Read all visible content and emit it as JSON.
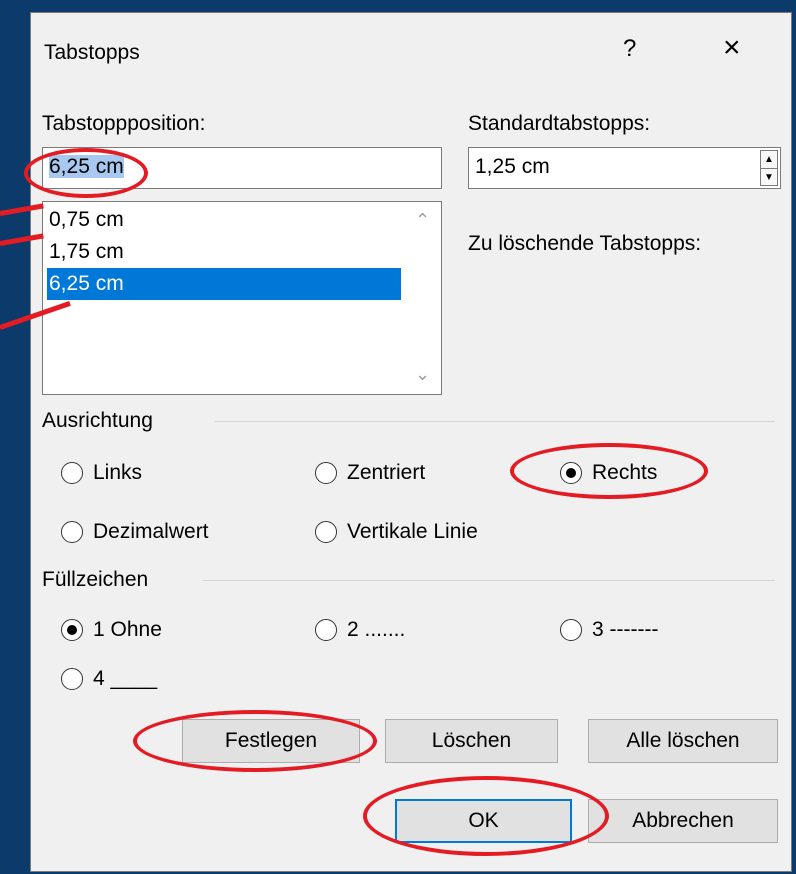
{
  "dialog": {
    "title": "Tabstopps",
    "help_label": "?",
    "close_label": "×"
  },
  "tab_position": {
    "label": "Tabstoppposition:",
    "value": "6,25 cm",
    "items": [
      "0,75 cm",
      "1,75 cm",
      "6,25 cm"
    ],
    "selected_index": 2
  },
  "default_tabs": {
    "label": "Standardtabstopps:",
    "value": "1,25 cm"
  },
  "to_delete": {
    "label": "Zu löschende Tabstopps:"
  },
  "alignment": {
    "label": "Ausrichtung",
    "options": [
      "Links",
      "Zentriert",
      "Rechts",
      "Dezimalwert",
      "Vertikale Linie"
    ],
    "selected": "Rechts"
  },
  "leader": {
    "label": "Füllzeichen",
    "options": [
      "1 Ohne",
      "2 .......",
      "3 -------",
      "4 ____"
    ],
    "selected": "1 Ohne"
  },
  "buttons": {
    "set": "Festlegen",
    "clear": "Löschen",
    "clear_all": "Alle löschen",
    "ok": "OK",
    "cancel": "Abbrechen"
  },
  "colors": {
    "background": "#0c3a6a",
    "dialog": "#f0f0f0",
    "selection": "#0078d7",
    "annotation": "#e41b23"
  }
}
